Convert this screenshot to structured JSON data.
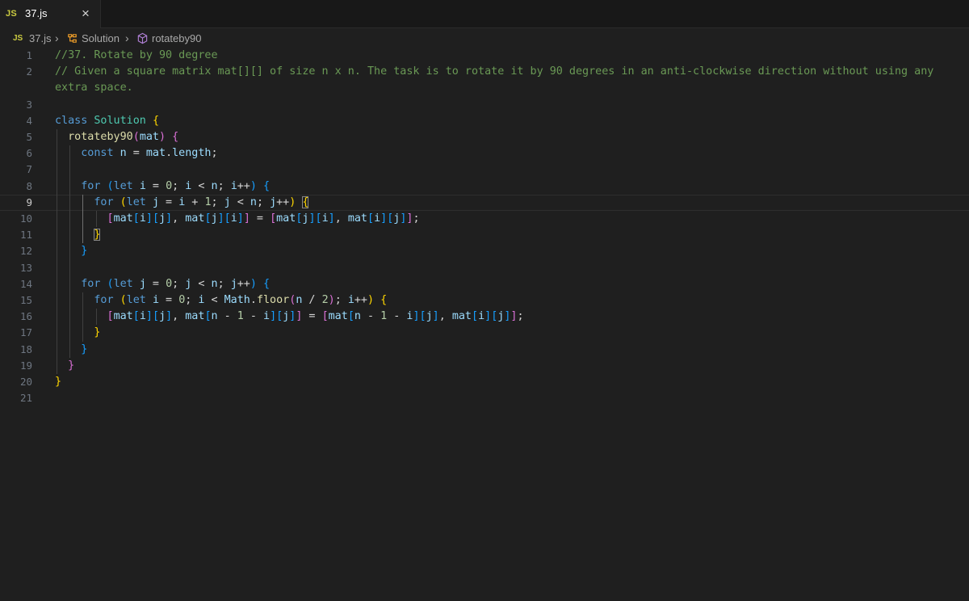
{
  "tab": {
    "badge": "JS",
    "label": "37.js",
    "close": "×"
  },
  "breadcrumb": {
    "file_badge": "JS",
    "file": "37.js",
    "class": "Solution",
    "method": "rotateby90"
  },
  "colors": {
    "comment": "#6a9955",
    "keyword": "#569cd6",
    "class": "#4ec9b0",
    "function": "#dcdcaa",
    "variable": "#9cdcfe",
    "number": "#b5cea8",
    "bracket1": "#ffd700",
    "bracket2": "#da70d6",
    "bracket3": "#179fff"
  },
  "editor": {
    "current_line": 9,
    "lines": [
      {
        "n": "1",
        "tokens": [
          [
            "//37. Rotate by 90 degree",
            "c-comment"
          ]
        ]
      },
      {
        "n": "2",
        "tokens": [
          [
            "// Given a square matrix mat[][] of size n x n. The task is to rotate it by 90 degrees in an anti-clockwise direction without using any",
            "c-comment"
          ]
        ]
      },
      {
        "n": "",
        "tokens": [
          [
            "extra space.",
            "c-comment"
          ]
        ]
      },
      {
        "n": "3",
        "tokens": []
      },
      {
        "n": "4",
        "tokens": [
          [
            "class ",
            "c-kw"
          ],
          [
            "Solution",
            "c-cls"
          ],
          [
            " ",
            "c-op"
          ],
          [
            "{",
            "b1"
          ]
        ]
      },
      {
        "n": "5",
        "tokens": [
          [
            "  ",
            "c-op"
          ],
          [
            "rotateby90",
            "c-fn"
          ],
          [
            "(",
            "b2"
          ],
          [
            "mat",
            "c-var"
          ],
          [
            ")",
            "b2"
          ],
          [
            " ",
            "c-op"
          ],
          [
            "{",
            "b2"
          ]
        ]
      },
      {
        "n": "6",
        "tokens": [
          [
            "    ",
            "c-op"
          ],
          [
            "const ",
            "c-kw"
          ],
          [
            "n",
            "c-var"
          ],
          [
            " = ",
            "c-op"
          ],
          [
            "mat",
            "c-var"
          ],
          [
            ".",
            "c-op"
          ],
          [
            "length",
            "c-var"
          ],
          [
            ";",
            "c-op"
          ]
        ]
      },
      {
        "n": "7",
        "tokens": []
      },
      {
        "n": "8",
        "tokens": [
          [
            "    ",
            "c-op"
          ],
          [
            "for ",
            "c-kw"
          ],
          [
            "(",
            "b3"
          ],
          [
            "let ",
            "c-kw"
          ],
          [
            "i",
            "c-var"
          ],
          [
            " = ",
            "c-op"
          ],
          [
            "0",
            "c-num"
          ],
          [
            "; ",
            "c-op"
          ],
          [
            "i",
            "c-var"
          ],
          [
            " < ",
            "c-op"
          ],
          [
            "n",
            "c-var"
          ],
          [
            "; ",
            "c-op"
          ],
          [
            "i",
            "c-var"
          ],
          [
            "++",
            "c-op"
          ],
          [
            ")",
            "b3"
          ],
          [
            " ",
            "c-op"
          ],
          [
            "{",
            "b3"
          ]
        ]
      },
      {
        "n": "9",
        "tokens": [
          [
            "      ",
            "c-op"
          ],
          [
            "for ",
            "c-kw"
          ],
          [
            "(",
            "b1"
          ],
          [
            "let ",
            "c-kw"
          ],
          [
            "j",
            "c-var"
          ],
          [
            " = ",
            "c-op"
          ],
          [
            "i",
            "c-var"
          ],
          [
            " + ",
            "c-op"
          ],
          [
            "1",
            "c-num"
          ],
          [
            "; ",
            "c-op"
          ],
          [
            "j",
            "c-var"
          ],
          [
            " < ",
            "c-op"
          ],
          [
            "n",
            "c-var"
          ],
          [
            "; ",
            "c-op"
          ],
          [
            "j",
            "c-var"
          ],
          [
            "++",
            "c-op"
          ],
          [
            ")",
            "b1"
          ],
          [
            " ",
            "c-op"
          ],
          [
            "{",
            "b1 bracket-box"
          ]
        ]
      },
      {
        "n": "10",
        "tokens": [
          [
            "        ",
            "c-op"
          ],
          [
            "[",
            "b2"
          ],
          [
            "mat",
            "c-var"
          ],
          [
            "[",
            "b3"
          ],
          [
            "i",
            "c-var"
          ],
          [
            "]",
            "b3"
          ],
          [
            "[",
            "b3"
          ],
          [
            "j",
            "c-var"
          ],
          [
            "]",
            "b3"
          ],
          [
            ", ",
            "c-op"
          ],
          [
            "mat",
            "c-var"
          ],
          [
            "[",
            "b3"
          ],
          [
            "j",
            "c-var"
          ],
          [
            "]",
            "b3"
          ],
          [
            "[",
            "b3"
          ],
          [
            "i",
            "c-var"
          ],
          [
            "]",
            "b3"
          ],
          [
            "]",
            "b2"
          ],
          [
            " = ",
            "c-op"
          ],
          [
            "[",
            "b2"
          ],
          [
            "mat",
            "c-var"
          ],
          [
            "[",
            "b3"
          ],
          [
            "j",
            "c-var"
          ],
          [
            "]",
            "b3"
          ],
          [
            "[",
            "b3"
          ],
          [
            "i",
            "c-var"
          ],
          [
            "]",
            "b3"
          ],
          [
            ", ",
            "c-op"
          ],
          [
            "mat",
            "c-var"
          ],
          [
            "[",
            "b3"
          ],
          [
            "i",
            "c-var"
          ],
          [
            "]",
            "b3"
          ],
          [
            "[",
            "b3"
          ],
          [
            "j",
            "c-var"
          ],
          [
            "]",
            "b3"
          ],
          [
            "]",
            "b2"
          ],
          [
            ";",
            "c-op"
          ]
        ]
      },
      {
        "n": "11",
        "tokens": [
          [
            "      ",
            "c-op"
          ],
          [
            "}",
            "b1 bracket-box"
          ]
        ]
      },
      {
        "n": "12",
        "tokens": [
          [
            "    ",
            "c-op"
          ],
          [
            "}",
            "b3"
          ]
        ]
      },
      {
        "n": "13",
        "tokens": []
      },
      {
        "n": "14",
        "tokens": [
          [
            "    ",
            "c-op"
          ],
          [
            "for ",
            "c-kw"
          ],
          [
            "(",
            "b3"
          ],
          [
            "let ",
            "c-kw"
          ],
          [
            "j",
            "c-var"
          ],
          [
            " = ",
            "c-op"
          ],
          [
            "0",
            "c-num"
          ],
          [
            "; ",
            "c-op"
          ],
          [
            "j",
            "c-var"
          ],
          [
            " < ",
            "c-op"
          ],
          [
            "n",
            "c-var"
          ],
          [
            "; ",
            "c-op"
          ],
          [
            "j",
            "c-var"
          ],
          [
            "++",
            "c-op"
          ],
          [
            ")",
            "b3"
          ],
          [
            " ",
            "c-op"
          ],
          [
            "{",
            "b3"
          ]
        ]
      },
      {
        "n": "15",
        "tokens": [
          [
            "      ",
            "c-op"
          ],
          [
            "for ",
            "c-kw"
          ],
          [
            "(",
            "b1"
          ],
          [
            "let ",
            "c-kw"
          ],
          [
            "i",
            "c-var"
          ],
          [
            " = ",
            "c-op"
          ],
          [
            "0",
            "c-num"
          ],
          [
            "; ",
            "c-op"
          ],
          [
            "i",
            "c-var"
          ],
          [
            " < ",
            "c-op"
          ],
          [
            "Math",
            "c-var"
          ],
          [
            ".",
            "c-op"
          ],
          [
            "floor",
            "c-fn"
          ],
          [
            "(",
            "b2"
          ],
          [
            "n",
            "c-var"
          ],
          [
            " / ",
            "c-op"
          ],
          [
            "2",
            "c-num"
          ],
          [
            ")",
            "b2"
          ],
          [
            "; ",
            "c-op"
          ],
          [
            "i",
            "c-var"
          ],
          [
            "++",
            "c-op"
          ],
          [
            ")",
            "b1"
          ],
          [
            " ",
            "c-op"
          ],
          [
            "{",
            "b1"
          ]
        ]
      },
      {
        "n": "16",
        "tokens": [
          [
            "        ",
            "c-op"
          ],
          [
            "[",
            "b2"
          ],
          [
            "mat",
            "c-var"
          ],
          [
            "[",
            "b3"
          ],
          [
            "i",
            "c-var"
          ],
          [
            "]",
            "b3"
          ],
          [
            "[",
            "b3"
          ],
          [
            "j",
            "c-var"
          ],
          [
            "]",
            "b3"
          ],
          [
            ", ",
            "c-op"
          ],
          [
            "mat",
            "c-var"
          ],
          [
            "[",
            "b3"
          ],
          [
            "n",
            "c-var"
          ],
          [
            " - ",
            "c-op"
          ],
          [
            "1",
            "c-num"
          ],
          [
            " - ",
            "c-op"
          ],
          [
            "i",
            "c-var"
          ],
          [
            "]",
            "b3"
          ],
          [
            "[",
            "b3"
          ],
          [
            "j",
            "c-var"
          ],
          [
            "]",
            "b3"
          ],
          [
            "]",
            "b2"
          ],
          [
            " = ",
            "c-op"
          ],
          [
            "[",
            "b2"
          ],
          [
            "mat",
            "c-var"
          ],
          [
            "[",
            "b3"
          ],
          [
            "n",
            "c-var"
          ],
          [
            " - ",
            "c-op"
          ],
          [
            "1",
            "c-num"
          ],
          [
            " - ",
            "c-op"
          ],
          [
            "i",
            "c-var"
          ],
          [
            "]",
            "b3"
          ],
          [
            "[",
            "b3"
          ],
          [
            "j",
            "c-var"
          ],
          [
            "]",
            "b3"
          ],
          [
            ", ",
            "c-op"
          ],
          [
            "mat",
            "c-var"
          ],
          [
            "[",
            "b3"
          ],
          [
            "i",
            "c-var"
          ],
          [
            "]",
            "b3"
          ],
          [
            "[",
            "b3"
          ],
          [
            "j",
            "c-var"
          ],
          [
            "]",
            "b3"
          ],
          [
            "]",
            "b2"
          ],
          [
            ";",
            "c-op"
          ]
        ]
      },
      {
        "n": "17",
        "tokens": [
          [
            "      ",
            "c-op"
          ],
          [
            "}",
            "b1"
          ]
        ]
      },
      {
        "n": "18",
        "tokens": [
          [
            "    ",
            "c-op"
          ],
          [
            "}",
            "b3"
          ]
        ]
      },
      {
        "n": "19",
        "tokens": [
          [
            "  ",
            "c-op"
          ],
          [
            "}",
            "b2"
          ]
        ]
      },
      {
        "n": "20",
        "tokens": [
          [
            "}",
            "b1"
          ]
        ]
      },
      {
        "n": "21",
        "tokens": []
      }
    ]
  }
}
